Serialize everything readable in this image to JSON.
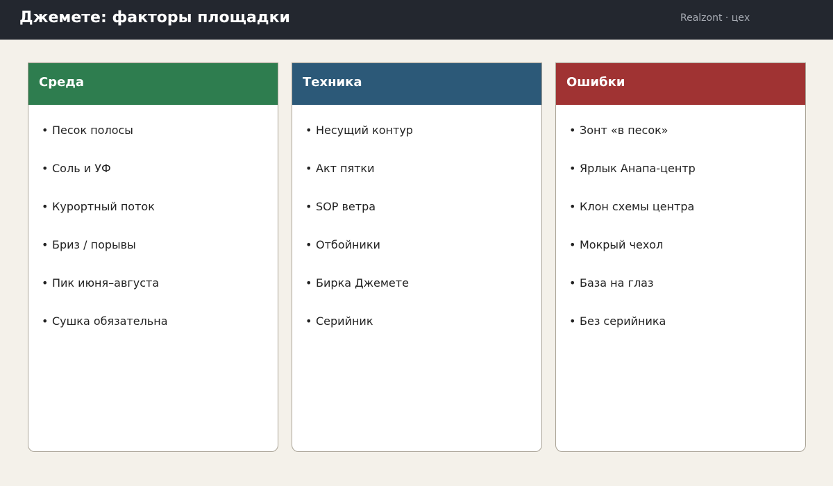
{
  "header": {
    "title": "Джемете: факторы площадки",
    "meta": "Realzont · цех"
  },
  "colors": {
    "background": "#f4f1ea",
    "header_bg": "#23272f",
    "card_env": "#2e7d4f",
    "card_tech": "#2c5978",
    "card_errors": "#a03333"
  },
  "cards": [
    {
      "title": "Среда",
      "items": [
        "Песок полосы",
        "Соль и УФ",
        "Курортный поток",
        "Бриз / порывы",
        "Пик июня–августа",
        "Сушка обязательна"
      ]
    },
    {
      "title": "Техника",
      "items": [
        "Несущий контур",
        "Акт пятки",
        "SOP ветра",
        "Отбойники",
        "Бирка Джемете",
        "Серийник"
      ]
    },
    {
      "title": "Ошибки",
      "items": [
        "Зонт «в песок»",
        "Ярлык Анапа-центр",
        "Клон схемы центра",
        "Мокрый чехол",
        "База на глаз",
        "Без серийника"
      ]
    }
  ]
}
